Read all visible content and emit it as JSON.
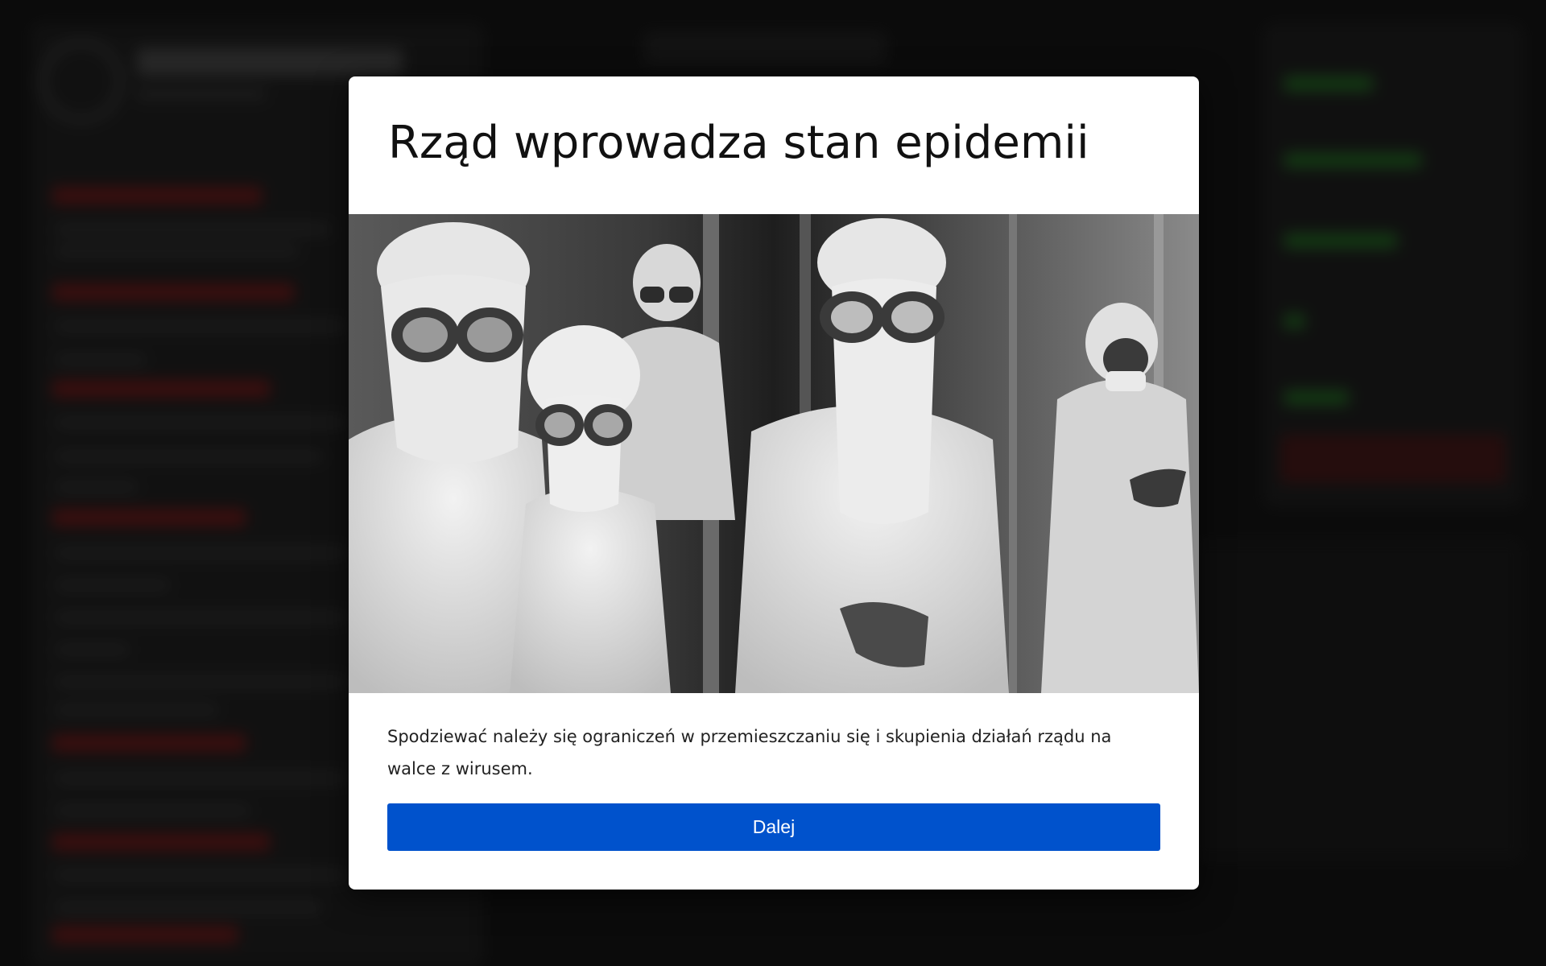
{
  "modal": {
    "title": "Rząd wprowadza stan epidemii",
    "image": {
      "description_icon": "photo-people-in-protective-suits-and-goggles"
    },
    "body_text": "Spodziewać należy się ograniczeń w przemieszczaniu się i skupienia działań rządu na walce z wirusem.",
    "button_label": "Dalej"
  },
  "colors": {
    "button_bg": "#0052cc",
    "button_text": "#ffffff",
    "modal_bg": "#ffffff",
    "overlay": "#000000"
  }
}
